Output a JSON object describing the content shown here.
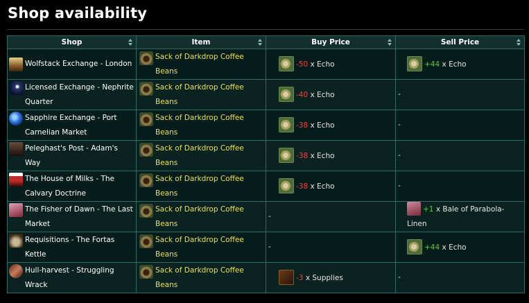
{
  "title": "Shop availability",
  "columns": [
    "Shop",
    "Item",
    "Buy Price",
    "Sell Price"
  ],
  "rows": [
    {
      "shop": "Wolfstack Exchange - London",
      "item": "Sack of Darkdrop Coffee Beans",
      "buy": {
        "amount": "-50",
        "unit": "x Echo"
      },
      "sell": {
        "amount": "+44",
        "unit": "x Echo"
      }
    },
    {
      "shop": "Licensed Exchange - Nephrite Quarter",
      "item": "Sack of Darkdrop Coffee Beans",
      "buy": {
        "amount": "-40",
        "unit": "x Echo"
      },
      "sell": {
        "empty": "-"
      }
    },
    {
      "shop": "Sapphire Exchange - Port Carnelian Market",
      "item": "Sack of Darkdrop Coffee Beans",
      "buy": {
        "amount": "-38",
        "unit": "x Echo"
      },
      "sell": {
        "empty": "-"
      }
    },
    {
      "shop": "Peleghast's Post - Adam's Way",
      "item": "Sack of Darkdrop Coffee Beans",
      "buy": {
        "amount": "-38",
        "unit": "x Echo"
      },
      "sell": {
        "empty": "-"
      }
    },
    {
      "shop": "The House of Milks - The Calvary Doctrine",
      "item": "Sack of Darkdrop Coffee Beans",
      "buy": {
        "amount": "-38",
        "unit": "x Echo"
      },
      "sell": {
        "empty": "-"
      }
    },
    {
      "shop": "The Fisher of Dawn - The Last Market",
      "item": "Sack of Darkdrop Coffee Beans",
      "buy": {
        "empty": "-"
      },
      "sell": {
        "amount": "+1",
        "unit": "x Bale of Parabola-Linen"
      }
    },
    {
      "shop": "Requisitions - The Fortas Kettle",
      "item": "Sack of Darkdrop Coffee Beans",
      "buy": {
        "empty": "-"
      },
      "sell": {
        "amount": "+44",
        "unit": "x Echo"
      }
    },
    {
      "shop": "Hull-harvest - Struggling Wrack",
      "item": "Sack of Darkdrop Coffee Beans",
      "buy": {
        "amount": "-3",
        "unit": "x Supplies"
      },
      "sell": {
        "empty": "-"
      }
    }
  ],
  "icons": {
    "shop": [
      "wolfstack-exchange-icon",
      "licensed-exchange-icon",
      "sapphire-exchange-icon",
      "peleghasts-post-icon",
      "house-of-milks-icon",
      "fisher-of-dawn-icon",
      "requisitions-icon",
      "hull-harvest-icon"
    ],
    "item": "coffee-sack-icon",
    "echo": "echo-icon",
    "supplies": "supplies-icon",
    "linen": "parabola-linen-icon"
  },
  "colors": {
    "negative": "#ff3b3b",
    "positive": "#59c93a",
    "item_link": "#e8e05a",
    "header_bg": "#13302c",
    "border": "#2d6a64"
  }
}
